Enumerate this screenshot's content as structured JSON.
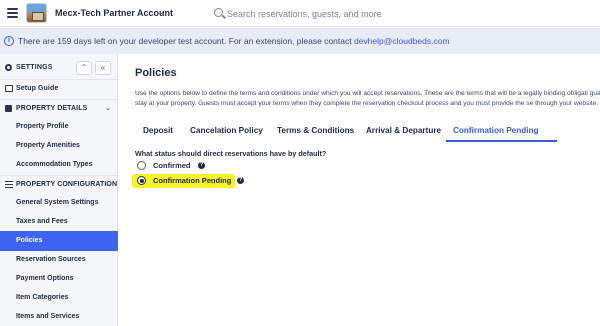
{
  "topbar": {
    "account_name": "Mecx-Tech Partner Account",
    "search_placeholder": "Search reservations, guests, and more"
  },
  "banner": {
    "text": "There are 159 days left on your developer test account. For an extension, please contact ",
    "link": "devhelp@cloudbeds.com"
  },
  "sidebar": {
    "settings_label": "SETTINGS",
    "items": [
      {
        "label": "Setup Guide"
      },
      {
        "label": "PROPERTY DETAILS"
      },
      {
        "label": "Property Profile"
      },
      {
        "label": "Property Amenities"
      },
      {
        "label": "Accommodation Types"
      },
      {
        "label": "PROPERTY CONFIGURATION"
      },
      {
        "label": "General System Settings"
      },
      {
        "label": "Taxes and Fees"
      },
      {
        "label": "Policies"
      },
      {
        "label": "Reservation Sources"
      },
      {
        "label": "Payment Options"
      },
      {
        "label": "Item Categories"
      },
      {
        "label": "Items and Services"
      }
    ]
  },
  "main": {
    "title": "Policies",
    "intro": "Use the options below to define the terms and conditions under which you will accept reservations. These are the terms that will be a legally binding obligati guarantee a room stay at your property. Guests must accept your terms when they complete the reservation checkout process and you must provide the se through your website.",
    "tabs": [
      {
        "label": "Deposit"
      },
      {
        "label": "Cancelation Policy"
      },
      {
        "label": "Terms & Conditions"
      },
      {
        "label": "Arrival & Departure"
      },
      {
        "label": "Confirmation Pending"
      }
    ],
    "question": "What status should direct reservations have by default?",
    "options": [
      {
        "label": "Confirmed",
        "selected": false
      },
      {
        "label": "Confirmation Pending",
        "selected": true
      }
    ]
  },
  "colors": {
    "accent": "#3b5bdb",
    "sidebar_active": "#3d63f0",
    "highlight": "#f5f22a",
    "banner_bg": "#e8ecf7"
  }
}
